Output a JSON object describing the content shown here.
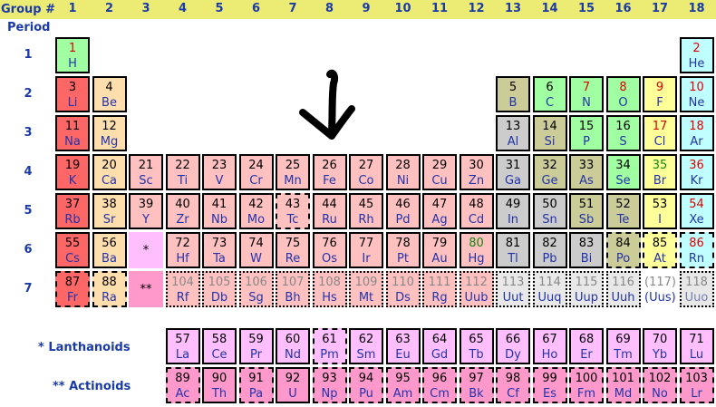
{
  "header": {
    "group_label": "Group #",
    "period_label": "Period",
    "groups": [
      "1",
      "2",
      "3",
      "4",
      "5",
      "6",
      "7",
      "8",
      "9",
      "10",
      "11",
      "12",
      "13",
      "14",
      "15",
      "16",
      "17",
      "18"
    ],
    "periods": [
      "1",
      "2",
      "3",
      "4",
      "5",
      "6",
      "7"
    ]
  },
  "series_labels": {
    "lanthanoids": "* Lanthanoids",
    "actinoids": "** Actinoids"
  },
  "colors": {
    "header_bar": "#ecec74",
    "label_text": "#1a3aa8",
    "alkali_metal": "#ff6666",
    "alkaline_earth": "#ffdead",
    "transition_metal": "#ffc0c0",
    "post_transition_metal": "#cccccc",
    "metalloid": "#cccc99",
    "nonmetal": "#a0ffa0",
    "halogen": "#ffff99",
    "noble_gas": "#c0ffff",
    "lanthanoid": "#ffbfff",
    "actinoid": "#ff99cc",
    "unknown": "#e8e8e8"
  },
  "pointer_annotation": "hand-drawn-down-arrow",
  "elements": [
    {
      "n": "1",
      "s": "H",
      "g": 1,
      "p": 1,
      "c": "nonmetal",
      "nc": "red"
    },
    {
      "n": "2",
      "s": "He",
      "g": 18,
      "p": 1,
      "c": "noble_gas",
      "nc": "red"
    },
    {
      "n": "3",
      "s": "Li",
      "g": 1,
      "p": 2,
      "c": "alkali_metal"
    },
    {
      "n": "4",
      "s": "Be",
      "g": 2,
      "p": 2,
      "c": "alkaline_earth"
    },
    {
      "n": "5",
      "s": "B",
      "g": 13,
      "p": 2,
      "c": "metalloid"
    },
    {
      "n": "6",
      "s": "C",
      "g": 14,
      "p": 2,
      "c": "nonmetal"
    },
    {
      "n": "7",
      "s": "N",
      "g": 15,
      "p": 2,
      "c": "nonmetal",
      "nc": "red"
    },
    {
      "n": "8",
      "s": "O",
      "g": 16,
      "p": 2,
      "c": "nonmetal",
      "nc": "red"
    },
    {
      "n": "9",
      "s": "F",
      "g": 17,
      "p": 2,
      "c": "halogen",
      "nc": "red"
    },
    {
      "n": "10",
      "s": "Ne",
      "g": 18,
      "p": 2,
      "c": "noble_gas",
      "nc": "red"
    },
    {
      "n": "11",
      "s": "Na",
      "g": 1,
      "p": 3,
      "c": "alkali_metal"
    },
    {
      "n": "12",
      "s": "Mg",
      "g": 2,
      "p": 3,
      "c": "alkaline_earth"
    },
    {
      "n": "13",
      "s": "Al",
      "g": 13,
      "p": 3,
      "c": "post_transition_metal"
    },
    {
      "n": "14",
      "s": "Si",
      "g": 14,
      "p": 3,
      "c": "metalloid"
    },
    {
      "n": "15",
      "s": "P",
      "g": 15,
      "p": 3,
      "c": "nonmetal"
    },
    {
      "n": "16",
      "s": "S",
      "g": 16,
      "p": 3,
      "c": "nonmetal"
    },
    {
      "n": "17",
      "s": "Cl",
      "g": 17,
      "p": 3,
      "c": "halogen",
      "nc": "red"
    },
    {
      "n": "18",
      "s": "Ar",
      "g": 18,
      "p": 3,
      "c": "noble_gas",
      "nc": "red"
    },
    {
      "n": "19",
      "s": "K",
      "g": 1,
      "p": 4,
      "c": "alkali_metal"
    },
    {
      "n": "20",
      "s": "Ca",
      "g": 2,
      "p": 4,
      "c": "alkaline_earth"
    },
    {
      "n": "21",
      "s": "Sc",
      "g": 3,
      "p": 4,
      "c": "transition_metal"
    },
    {
      "n": "22",
      "s": "Ti",
      "g": 4,
      "p": 4,
      "c": "transition_metal"
    },
    {
      "n": "23",
      "s": "V",
      "g": 5,
      "p": 4,
      "c": "transition_metal"
    },
    {
      "n": "24",
      "s": "Cr",
      "g": 6,
      "p": 4,
      "c": "transition_metal"
    },
    {
      "n": "25",
      "s": "Mn",
      "g": 7,
      "p": 4,
      "c": "transition_metal"
    },
    {
      "n": "26",
      "s": "Fe",
      "g": 8,
      "p": 4,
      "c": "transition_metal"
    },
    {
      "n": "27",
      "s": "Co",
      "g": 9,
      "p": 4,
      "c": "transition_metal"
    },
    {
      "n": "28",
      "s": "Ni",
      "g": 10,
      "p": 4,
      "c": "transition_metal"
    },
    {
      "n": "29",
      "s": "Cu",
      "g": 11,
      "p": 4,
      "c": "transition_metal"
    },
    {
      "n": "30",
      "s": "Zn",
      "g": 12,
      "p": 4,
      "c": "transition_metal"
    },
    {
      "n": "31",
      "s": "Ga",
      "g": 13,
      "p": 4,
      "c": "post_transition_metal"
    },
    {
      "n": "32",
      "s": "Ge",
      "g": 14,
      "p": 4,
      "c": "metalloid"
    },
    {
      "n": "33",
      "s": "As",
      "g": 15,
      "p": 4,
      "c": "metalloid"
    },
    {
      "n": "34",
      "s": "Se",
      "g": 16,
      "p": 4,
      "c": "nonmetal"
    },
    {
      "n": "35",
      "s": "Br",
      "g": 17,
      "p": 4,
      "c": "halogen",
      "nc": "green"
    },
    {
      "n": "36",
      "s": "Kr",
      "g": 18,
      "p": 4,
      "c": "noble_gas",
      "nc": "red"
    },
    {
      "n": "37",
      "s": "Rb",
      "g": 1,
      "p": 5,
      "c": "alkali_metal"
    },
    {
      "n": "38",
      "s": "Sr",
      "g": 2,
      "p": 5,
      "c": "alkaline_earth"
    },
    {
      "n": "39",
      "s": "Y",
      "g": 3,
      "p": 5,
      "c": "transition_metal"
    },
    {
      "n": "40",
      "s": "Zr",
      "g": 4,
      "p": 5,
      "c": "transition_metal"
    },
    {
      "n": "41",
      "s": "Nb",
      "g": 5,
      "p": 5,
      "c": "transition_metal"
    },
    {
      "n": "42",
      "s": "Mo",
      "g": 6,
      "p": 5,
      "c": "transition_metal"
    },
    {
      "n": "43",
      "s": "Tc",
      "g": 7,
      "p": 5,
      "c": "transition_metal",
      "b": "dashed"
    },
    {
      "n": "44",
      "s": "Ru",
      "g": 8,
      "p": 5,
      "c": "transition_metal"
    },
    {
      "n": "45",
      "s": "Rh",
      "g": 9,
      "p": 5,
      "c": "transition_metal"
    },
    {
      "n": "46",
      "s": "Pd",
      "g": 10,
      "p": 5,
      "c": "transition_metal"
    },
    {
      "n": "47",
      "s": "Ag",
      "g": 11,
      "p": 5,
      "c": "transition_metal"
    },
    {
      "n": "48",
      "s": "Cd",
      "g": 12,
      "p": 5,
      "c": "transition_metal"
    },
    {
      "n": "49",
      "s": "In",
      "g": 13,
      "p": 5,
      "c": "post_transition_metal"
    },
    {
      "n": "50",
      "s": "Sn",
      "g": 14,
      "p": 5,
      "c": "post_transition_metal"
    },
    {
      "n": "51",
      "s": "Sb",
      "g": 15,
      "p": 5,
      "c": "metalloid"
    },
    {
      "n": "52",
      "s": "Te",
      "g": 16,
      "p": 5,
      "c": "metalloid"
    },
    {
      "n": "53",
      "s": "I",
      "g": 17,
      "p": 5,
      "c": "halogen"
    },
    {
      "n": "54",
      "s": "Xe",
      "g": 18,
      "p": 5,
      "c": "noble_gas",
      "nc": "red"
    },
    {
      "n": "55",
      "s": "Cs",
      "g": 1,
      "p": 6,
      "c": "alkali_metal"
    },
    {
      "n": "56",
      "s": "Ba",
      "g": 2,
      "p": 6,
      "c": "alkaline_earth"
    },
    {
      "n": "*",
      "s": "",
      "g": 3,
      "p": 6,
      "c": "lanthanoid",
      "b": "none"
    },
    {
      "n": "72",
      "s": "Hf",
      "g": 4,
      "p": 6,
      "c": "transition_metal"
    },
    {
      "n": "73",
      "s": "Ta",
      "g": 5,
      "p": 6,
      "c": "transition_metal"
    },
    {
      "n": "74",
      "s": "W",
      "g": 6,
      "p": 6,
      "c": "transition_metal"
    },
    {
      "n": "75",
      "s": "Re",
      "g": 7,
      "p": 6,
      "c": "transition_metal"
    },
    {
      "n": "76",
      "s": "Os",
      "g": 8,
      "p": 6,
      "c": "transition_metal"
    },
    {
      "n": "77",
      "s": "Ir",
      "g": 9,
      "p": 6,
      "c": "transition_metal"
    },
    {
      "n": "78",
      "s": "Pt",
      "g": 10,
      "p": 6,
      "c": "transition_metal"
    },
    {
      "n": "79",
      "s": "Au",
      "g": 11,
      "p": 6,
      "c": "transition_metal"
    },
    {
      "n": "80",
      "s": "Hg",
      "g": 12,
      "p": 6,
      "c": "transition_metal",
      "nc": "green"
    },
    {
      "n": "81",
      "s": "Tl",
      "g": 13,
      "p": 6,
      "c": "post_transition_metal"
    },
    {
      "n": "82",
      "s": "Pb",
      "g": 14,
      "p": 6,
      "c": "post_transition_metal"
    },
    {
      "n": "83",
      "s": "Bi",
      "g": 15,
      "p": 6,
      "c": "post_transition_metal"
    },
    {
      "n": "84",
      "s": "Po",
      "g": 16,
      "p": 6,
      "c": "metalloid",
      "b": "dashed"
    },
    {
      "n": "85",
      "s": "At",
      "g": 17,
      "p": 6,
      "c": "halogen",
      "b": "dashed"
    },
    {
      "n": "86",
      "s": "Rn",
      "g": 18,
      "p": 6,
      "c": "noble_gas",
      "nc": "red",
      "b": "dashed"
    },
    {
      "n": "87",
      "s": "Fr",
      "g": 1,
      "p": 7,
      "c": "alkali_metal",
      "b": "dashed"
    },
    {
      "n": "88",
      "s": "Ra",
      "g": 2,
      "p": 7,
      "c": "alkaline_earth",
      "b": "dashed"
    },
    {
      "n": "**",
      "s": "",
      "g": 3,
      "p": 7,
      "c": "actinoid",
      "b": "none"
    },
    {
      "n": "104",
      "s": "Rf",
      "g": 4,
      "p": 7,
      "c": "transition_metal",
      "b": "dotted",
      "nc": "grey"
    },
    {
      "n": "105",
      "s": "Db",
      "g": 5,
      "p": 7,
      "c": "transition_metal",
      "b": "dotted",
      "nc": "grey"
    },
    {
      "n": "106",
      "s": "Sg",
      "g": 6,
      "p": 7,
      "c": "transition_metal",
      "b": "dotted",
      "nc": "grey"
    },
    {
      "n": "107",
      "s": "Bh",
      "g": 7,
      "p": 7,
      "c": "transition_metal",
      "b": "dotted",
      "nc": "grey"
    },
    {
      "n": "108",
      "s": "Hs",
      "g": 8,
      "p": 7,
      "c": "transition_metal",
      "b": "dotted",
      "nc": "grey"
    },
    {
      "n": "109",
      "s": "Mt",
      "g": 9,
      "p": 7,
      "c": "transition_metal",
      "b": "dotted",
      "nc": "grey"
    },
    {
      "n": "110",
      "s": "Ds",
      "g": 10,
      "p": 7,
      "c": "transition_metal",
      "b": "dotted",
      "nc": "grey"
    },
    {
      "n": "111",
      "s": "Rg",
      "g": 11,
      "p": 7,
      "c": "transition_metal",
      "b": "dotted",
      "nc": "grey"
    },
    {
      "n": "112",
      "s": "Uub",
      "g": 12,
      "p": 7,
      "c": "transition_metal",
      "b": "dotted",
      "nc": "grey"
    },
    {
      "n": "113",
      "s": "Uut",
      "g": 13,
      "p": 7,
      "c": "unknown",
      "b": "dotted",
      "nc": "grey"
    },
    {
      "n": "114",
      "s": "Uuq",
      "g": 14,
      "p": 7,
      "c": "unknown",
      "b": "dotted",
      "nc": "grey"
    },
    {
      "n": "115",
      "s": "Uup",
      "g": 15,
      "p": 7,
      "c": "unknown",
      "b": "dotted",
      "nc": "grey"
    },
    {
      "n": "116",
      "s": "Uuh",
      "g": 16,
      "p": 7,
      "c": "unknown",
      "b": "dotted",
      "nc": "grey"
    },
    {
      "n": "(117)",
      "s": "(Uus)",
      "g": 17,
      "p": 7,
      "c": "white",
      "b": "none",
      "nc": "grey"
    },
    {
      "n": "118",
      "s": "Uuo",
      "g": 18,
      "p": 7,
      "c": "unknown",
      "b": "dotted",
      "nc": "grey",
      "sc": "grey"
    },
    {
      "n": "57",
      "s": "La",
      "g": 4,
      "p": "L",
      "c": "lanthanoid"
    },
    {
      "n": "58",
      "s": "Ce",
      "g": 5,
      "p": "L",
      "c": "lanthanoid"
    },
    {
      "n": "59",
      "s": "Pr",
      "g": 6,
      "p": "L",
      "c": "lanthanoid"
    },
    {
      "n": "60",
      "s": "Nd",
      "g": 7,
      "p": "L",
      "c": "lanthanoid"
    },
    {
      "n": "61",
      "s": "Pm",
      "g": 8,
      "p": "L",
      "c": "lanthanoid",
      "b": "dashed"
    },
    {
      "n": "62",
      "s": "Sm",
      "g": 9,
      "p": "L",
      "c": "lanthanoid"
    },
    {
      "n": "63",
      "s": "Eu",
      "g": 10,
      "p": "L",
      "c": "lanthanoid"
    },
    {
      "n": "64",
      "s": "Gd",
      "g": 11,
      "p": "L",
      "c": "lanthanoid"
    },
    {
      "n": "65",
      "s": "Tb",
      "g": 12,
      "p": "L",
      "c": "lanthanoid"
    },
    {
      "n": "66",
      "s": "Dy",
      "g": 13,
      "p": "L",
      "c": "lanthanoid"
    },
    {
      "n": "67",
      "s": "Ho",
      "g": 14,
      "p": "L",
      "c": "lanthanoid"
    },
    {
      "n": "68",
      "s": "Er",
      "g": 15,
      "p": "L",
      "c": "lanthanoid"
    },
    {
      "n": "69",
      "s": "Tm",
      "g": 16,
      "p": "L",
      "c": "lanthanoid"
    },
    {
      "n": "70",
      "s": "Yb",
      "g": 17,
      "p": "L",
      "c": "lanthanoid"
    },
    {
      "n": "71",
      "s": "Lu",
      "g": 18,
      "p": "L",
      "c": "lanthanoid"
    },
    {
      "n": "89",
      "s": "Ac",
      "g": 4,
      "p": "A",
      "c": "actinoid",
      "b": "dashed"
    },
    {
      "n": "90",
      "s": "Th",
      "g": 5,
      "p": "A",
      "c": "actinoid"
    },
    {
      "n": "91",
      "s": "Pa",
      "g": 6,
      "p": "A",
      "c": "actinoid",
      "b": "dashed"
    },
    {
      "n": "92",
      "s": "U",
      "g": 7,
      "p": "A",
      "c": "actinoid"
    },
    {
      "n": "93",
      "s": "Np",
      "g": 8,
      "p": "A",
      "c": "actinoid",
      "b": "dashed"
    },
    {
      "n": "94",
      "s": "Pu",
      "g": 9,
      "p": "A",
      "c": "actinoid",
      "b": "dashed"
    },
    {
      "n": "95",
      "s": "Am",
      "g": 10,
      "p": "A",
      "c": "actinoid",
      "b": "dashed"
    },
    {
      "n": "96",
      "s": "Cm",
      "g": 11,
      "p": "A",
      "c": "actinoid",
      "b": "dashed"
    },
    {
      "n": "97",
      "s": "Bk",
      "g": 12,
      "p": "A",
      "c": "actinoid",
      "b": "dashed"
    },
    {
      "n": "98",
      "s": "Cf",
      "g": 13,
      "p": "A",
      "c": "actinoid",
      "b": "dashed"
    },
    {
      "n": "99",
      "s": "Es",
      "g": 14,
      "p": "A",
      "c": "actinoid",
      "b": "dashed"
    },
    {
      "n": "100",
      "s": "Fm",
      "g": 15,
      "p": "A",
      "c": "actinoid",
      "b": "dashed"
    },
    {
      "n": "101",
      "s": "Md",
      "g": 16,
      "p": "A",
      "c": "actinoid",
      "b": "dashed"
    },
    {
      "n": "102",
      "s": "No",
      "g": 17,
      "p": "A",
      "c": "actinoid",
      "b": "dashed"
    },
    {
      "n": "103",
      "s": "Lr",
      "g": 18,
      "p": "A",
      "c": "actinoid",
      "b": "dashed"
    }
  ]
}
